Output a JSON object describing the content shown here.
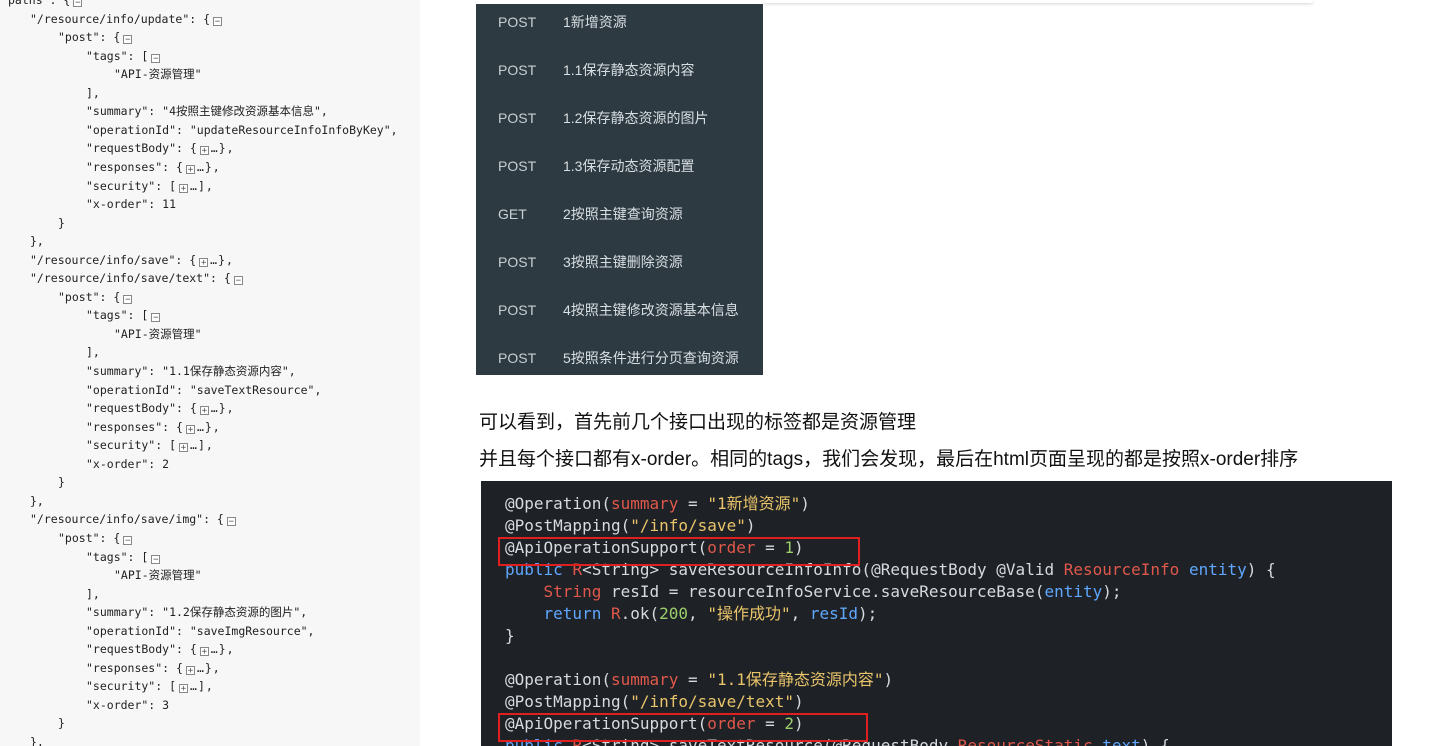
{
  "json_panel": {
    "lines": [
      {
        "t": "paths : {",
        "ind": 0,
        "tog": "minus",
        "tail": ""
      },
      {
        "t": "\"/resource/info/update\": {",
        "ind": 1,
        "tog": "minus",
        "tail": ""
      },
      {
        "t": "\"post\": {",
        "ind": 2,
        "tog": "minus",
        "tail": ""
      },
      {
        "t": "\"tags\": [",
        "ind": 3,
        "tog": "minus",
        "tail": ""
      },
      {
        "t": "\"API-资源管理\"",
        "ind": 4,
        "tog": "",
        "tail": ""
      },
      {
        "t": "],",
        "ind": 3,
        "tog": "",
        "tail": ""
      },
      {
        "t": "\"summary\": \"4按照主键修改资源基本信息\",",
        "ind": 3,
        "tog": "",
        "tail": ""
      },
      {
        "t": "\"operationId\": \"updateResourceInfoInfoByKey\",",
        "ind": 3,
        "tog": "",
        "tail": ""
      },
      {
        "t": "\"requestBody\": {",
        "ind": 3,
        "tog": "plus",
        "tail": "…},"
      },
      {
        "t": "\"responses\": {",
        "ind": 3,
        "tog": "plus",
        "tail": "…},"
      },
      {
        "t": "\"security\": [",
        "ind": 3,
        "tog": "plus",
        "tail": "…],"
      },
      {
        "t": "\"x-order\": 11",
        "ind": 3,
        "tog": "",
        "tail": ""
      },
      {
        "t": "}",
        "ind": 2,
        "tog": "",
        "tail": ""
      },
      {
        "t": "},",
        "ind": 1,
        "tog": "",
        "tail": ""
      },
      {
        "t": "\"/resource/info/save\": {",
        "ind": 1,
        "tog": "plus",
        "tail": "…},"
      },
      {
        "t": "\"/resource/info/save/text\": {",
        "ind": 1,
        "tog": "minus",
        "tail": ""
      },
      {
        "t": "\"post\": {",
        "ind": 2,
        "tog": "minus",
        "tail": ""
      },
      {
        "t": "\"tags\": [",
        "ind": 3,
        "tog": "minus",
        "tail": ""
      },
      {
        "t": "\"API-资源管理\"",
        "ind": 4,
        "tog": "",
        "tail": ""
      },
      {
        "t": "],",
        "ind": 3,
        "tog": "",
        "tail": ""
      },
      {
        "t": "\"summary\": \"1.1保存静态资源内容\",",
        "ind": 3,
        "tog": "",
        "tail": ""
      },
      {
        "t": "\"operationId\": \"saveTextResource\",",
        "ind": 3,
        "tog": "",
        "tail": ""
      },
      {
        "t": "\"requestBody\": {",
        "ind": 3,
        "tog": "plus",
        "tail": "…},"
      },
      {
        "t": "\"responses\": {",
        "ind": 3,
        "tog": "plus",
        "tail": "…},"
      },
      {
        "t": "\"security\": [",
        "ind": 3,
        "tog": "plus",
        "tail": "…],"
      },
      {
        "t": "\"x-order\": 2",
        "ind": 3,
        "tog": "",
        "tail": ""
      },
      {
        "t": "}",
        "ind": 2,
        "tog": "",
        "tail": ""
      },
      {
        "t": "},",
        "ind": 1,
        "tog": "",
        "tail": ""
      },
      {
        "t": "\"/resource/info/save/img\": {",
        "ind": 1,
        "tog": "minus",
        "tail": ""
      },
      {
        "t": "\"post\": {",
        "ind": 2,
        "tog": "minus",
        "tail": ""
      },
      {
        "t": "\"tags\": [",
        "ind": 3,
        "tog": "minus",
        "tail": ""
      },
      {
        "t": "\"API-资源管理\"",
        "ind": 4,
        "tog": "",
        "tail": ""
      },
      {
        "t": "],",
        "ind": 3,
        "tog": "",
        "tail": ""
      },
      {
        "t": "\"summary\": \"1.2保存静态资源的图片\",",
        "ind": 3,
        "tog": "",
        "tail": ""
      },
      {
        "t": "\"operationId\": \"saveImgResource\",",
        "ind": 3,
        "tog": "",
        "tail": ""
      },
      {
        "t": "\"requestBody\": {",
        "ind": 3,
        "tog": "plus",
        "tail": "…},"
      },
      {
        "t": "\"responses\": {",
        "ind": 3,
        "tog": "plus",
        "tail": "…},"
      },
      {
        "t": "\"security\": [",
        "ind": 3,
        "tog": "plus",
        "tail": "…],"
      },
      {
        "t": "\"x-order\": 3",
        "ind": 3,
        "tog": "",
        "tail": ""
      },
      {
        "t": "}",
        "ind": 2,
        "tog": "",
        "tail": ""
      },
      {
        "t": "},",
        "ind": 1,
        "tog": "",
        "tail": ""
      }
    ]
  },
  "api_menu": {
    "items": [
      {
        "method": "POST",
        "summary": "1新增资源"
      },
      {
        "method": "POST",
        "summary": "1.1保存静态资源内容"
      },
      {
        "method": "POST",
        "summary": "1.2保存静态资源的图片"
      },
      {
        "method": "POST",
        "summary": "1.3保存动态资源配置"
      },
      {
        "method": "GET",
        "summary": "2按照主键查询资源"
      },
      {
        "method": "POST",
        "summary": "3按照主键删除资源"
      },
      {
        "method": "POST",
        "summary": "4按照主键修改资源基本信息"
      },
      {
        "method": "POST",
        "summary": "5按照条件进行分页查询资源"
      }
    ]
  },
  "article": {
    "line1": "可以看到，首先前几个接口出现的标签都是资源管理",
    "line2": "并且每个接口都有x-order。相同的tags，我们会发现，最后在html页面呈现的都是按照x-order排序"
  },
  "code": {
    "lines": [
      [
        [
          "ann",
          "@Operation("
        ],
        [
          "prm",
          "summary"
        ],
        [
          "op",
          " = "
        ],
        [
          "str",
          "\"1新增资源\""
        ],
        [
          "ann",
          ")"
        ]
      ],
      [
        [
          "ann",
          "@PostMapping("
        ],
        [
          "str",
          "\"/info/save\""
        ],
        [
          "ann",
          ")"
        ]
      ],
      [
        [
          "ann",
          "@ApiOperationSupport("
        ],
        [
          "prm",
          "order"
        ],
        [
          "op",
          " = "
        ],
        [
          "num",
          "1"
        ],
        [
          "ann",
          ")"
        ]
      ],
      [
        [
          "kw",
          "public "
        ],
        [
          "typ",
          "R"
        ],
        [
          "op",
          "<String> saveResourceInfoInfo(@RequestBody @Valid "
        ],
        [
          "typ",
          "ResourceInfo "
        ],
        [
          "kw",
          "entity"
        ],
        [
          "op",
          ") {"
        ]
      ],
      [
        [
          "op",
          "    "
        ],
        [
          "typ",
          "String "
        ],
        [
          "op",
          "resId = resourceInfoService.saveResourceBase("
        ],
        [
          "kw",
          "entity"
        ],
        [
          "op",
          ");"
        ]
      ],
      [
        [
          "op",
          "    "
        ],
        [
          "kw",
          "return "
        ],
        [
          "typ",
          "R"
        ],
        [
          "op",
          ".ok("
        ],
        [
          "num",
          "200"
        ],
        [
          "op",
          ", "
        ],
        [
          "str",
          "\"操作成功\""
        ],
        [
          "op",
          ", "
        ],
        [
          "kw",
          "resId"
        ],
        [
          "op",
          ");"
        ]
      ],
      [
        [
          "op",
          "}"
        ]
      ],
      [
        [
          "op",
          ""
        ]
      ],
      [
        [
          "ann",
          "@Operation("
        ],
        [
          "prm",
          "summary"
        ],
        [
          "op",
          " = "
        ],
        [
          "str",
          "\"1.1保存静态资源内容\""
        ],
        [
          "ann",
          ")"
        ]
      ],
      [
        [
          "ann",
          "@PostMapping("
        ],
        [
          "str",
          "\"/info/save/text\""
        ],
        [
          "ann",
          ")"
        ]
      ],
      [
        [
          "ann",
          "@ApiOperationSupport("
        ],
        [
          "prm",
          "order"
        ],
        [
          "op",
          " = "
        ],
        [
          "num",
          "2"
        ],
        [
          "ann",
          ")"
        ]
      ],
      [
        [
          "kw",
          "public "
        ],
        [
          "typ",
          "R"
        ],
        [
          "op",
          "<String> saveTextResource(@RequestBody "
        ],
        [
          "typ",
          "ResourceStatic "
        ],
        [
          "kw",
          "text"
        ],
        [
          "op",
          ") {"
        ]
      ]
    ]
  },
  "colors": {
    "menu_bg": "#2d3a41",
    "code_bg": "#1e2126",
    "highlight": "#e02020"
  }
}
